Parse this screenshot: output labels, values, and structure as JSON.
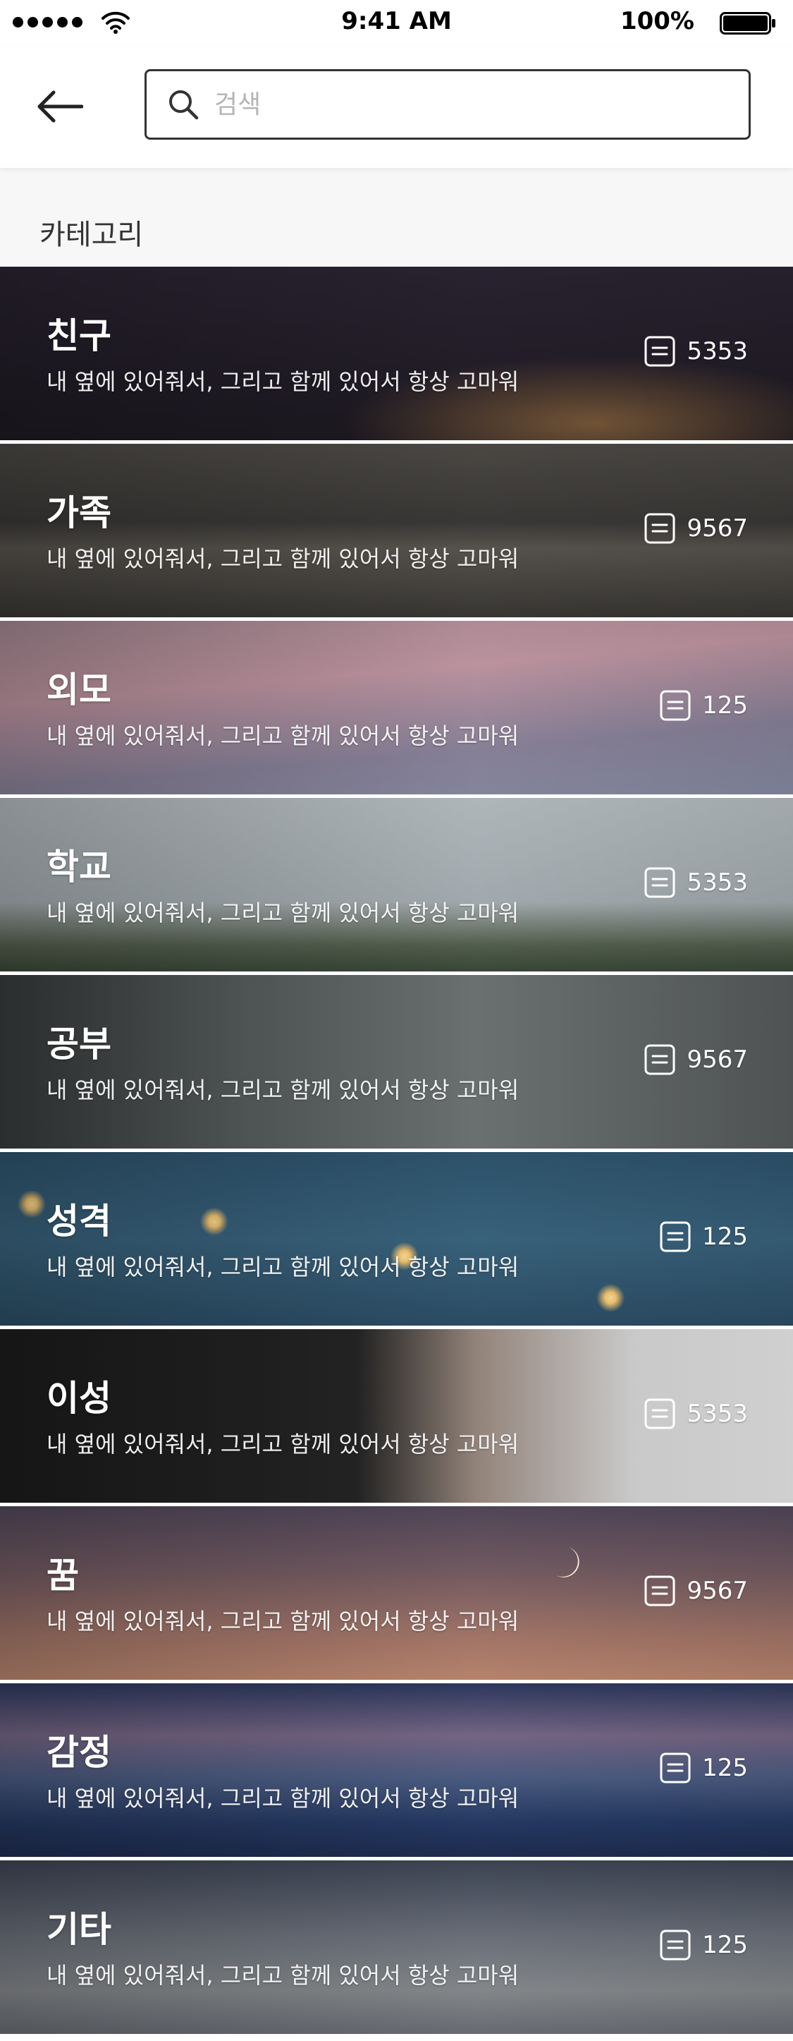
{
  "status_bar": {
    "time": "9:41 AM",
    "battery": "100%"
  },
  "search": {
    "placeholder": "검색",
    "value": ""
  },
  "section": {
    "title": "카테고리"
  },
  "categories": [
    {
      "name": "친구",
      "description": "내 옆에 있어줘서, 그리고 함께 있어서 항상 고마워",
      "count": "5353",
      "bg": "friend"
    },
    {
      "name": "가족",
      "description": "내 옆에 있어줘서, 그리고 함께 있어서 항상 고마워",
      "count": "9567",
      "bg": "family"
    },
    {
      "name": "외모",
      "description": "내 옆에 있어줘서, 그리고 함께 있어서 항상 고마워",
      "count": "125",
      "bg": "looks"
    },
    {
      "name": "학교",
      "description": "내 옆에 있어줘서, 그리고 함께 있어서 항상 고마워",
      "count": "5353",
      "bg": "school"
    },
    {
      "name": "공부",
      "description": "내 옆에 있어줘서, 그리고 함께 있어서 항상 고마워",
      "count": "9567",
      "bg": "study"
    },
    {
      "name": "성격",
      "description": "내 옆에 있어줘서, 그리고 함께 있어서 항상 고마워",
      "count": "125",
      "bg": "character"
    },
    {
      "name": "이성",
      "description": "내 옆에 있어줘서, 그리고 함께 있어서 항상 고마워",
      "count": "5353",
      "bg": "romance"
    },
    {
      "name": "꿈",
      "description": "내 옆에 있어줘서, 그리고 함께 있어서 항상 고마워",
      "count": "9567",
      "bg": "dream"
    },
    {
      "name": "감정",
      "description": "내 옆에 있어줘서, 그리고 함께 있어서 항상 고마워",
      "count": "125",
      "bg": "emotion"
    },
    {
      "name": "기타",
      "description": "내 옆에 있어줘서, 그리고 함께 있어서 항상 고마워",
      "count": "125",
      "bg": "etc"
    }
  ],
  "icons": {
    "back": "arrow-left-icon",
    "search": "search-icon",
    "post_count": "document-icon"
  }
}
